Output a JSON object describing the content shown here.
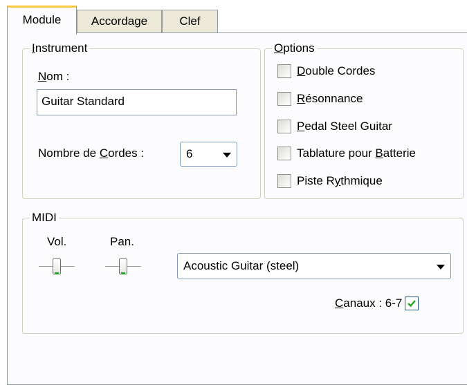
{
  "tabs": [
    {
      "label": "Module",
      "active": true
    },
    {
      "label": "Accordage",
      "active": false
    },
    {
      "label": "Clef",
      "active": false
    }
  ],
  "instrument": {
    "legend_u": "I",
    "legend_rest": "nstrument",
    "name_label_u": "N",
    "name_label_rest": "om :",
    "name_value": "Guitar Standard",
    "strings_label_pre": "Nombre de ",
    "strings_label_u": "C",
    "strings_label_rest": "ordes :",
    "strings_value": "6"
  },
  "options": {
    "legend_u": "O",
    "legend_rest": "ptions",
    "items": [
      {
        "pre": "",
        "u": "D",
        "post": "ouble Cordes",
        "checked": false
      },
      {
        "pre": "",
        "u": "R",
        "post": "ésonnance",
        "checked": false
      },
      {
        "pre": "",
        "u": "P",
        "post": "edal Steel Guitar",
        "checked": false
      },
      {
        "pre": "Tablature pour ",
        "u": "B",
        "post": "atterie",
        "checked": false
      },
      {
        "pre": "Piste R",
        "u": "y",
        "post": "thmique",
        "checked": false
      }
    ]
  },
  "midi": {
    "legend": "MIDI",
    "volume_label": "Vol.",
    "pan_label": "Pan.",
    "volume_level": 0.5,
    "pan_level": 0.5,
    "instrument_value": "Acoustic Guitar (steel)",
    "channels_label_u": "C",
    "channels_label_rest": "anaux : 6-7",
    "channels_checked": true
  },
  "colors": {
    "tab_highlight": "#ffc83c",
    "check_mark": "#21a121",
    "slider_accent": "#2ea12e"
  }
}
